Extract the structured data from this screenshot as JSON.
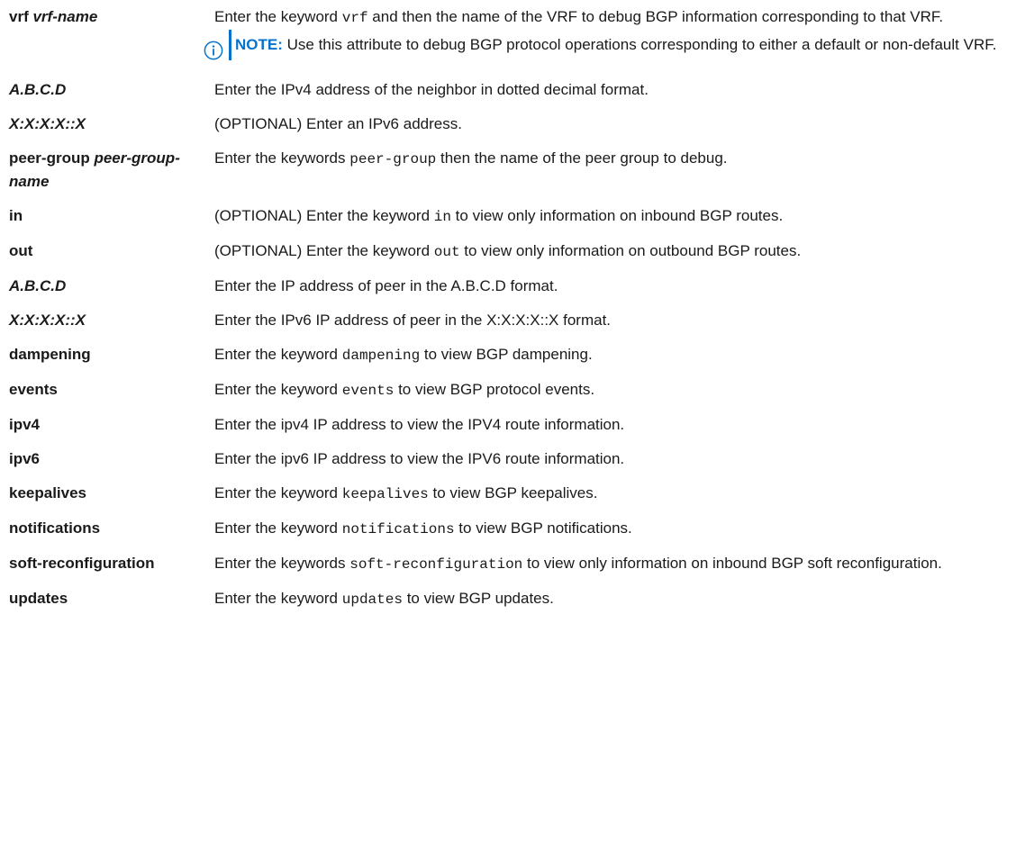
{
  "rows": [
    {
      "term": "vrf",
      "term_arg": "vrf-name",
      "desc": "Enter the keyword vrf and then the name of the VRF to debug BGP information corresponding to that VRF.",
      "desc_parts": [
        "Enter the keyword ",
        "vrf",
        " and then the name of the VRF to debug BGP information corresponding to that VRF."
      ],
      "note": {
        "label": "NOTE:",
        "text": " Use this attribute to debug BGP protocol operations corresponding to either a default or non-default VRF."
      }
    },
    {
      "term_arg": "A.B.C.D",
      "desc": "Enter the IPv4 address of the neighbor in dotted decimal format."
    },
    {
      "term_arg": "X:X:X:X::X",
      "desc": "(OPTIONAL) Enter an IPv6 address."
    },
    {
      "term": "peer-group",
      "term_arg": "peer-group-name",
      "desc_parts": [
        "Enter the keywords ",
        "peer-group",
        " then the name of the peer group to debug."
      ]
    },
    {
      "term": "in",
      "desc_parts": [
        "(OPTIONAL) Enter the keyword ",
        "in",
        " to view only information on inbound BGP routes."
      ]
    },
    {
      "term": "out",
      "desc_parts": [
        "(OPTIONAL) Enter the keyword ",
        "out",
        " to view only information on outbound BGP routes."
      ]
    },
    {
      "term_arg": "A.B.C.D",
      "desc": "Enter the IP address of peer in the A.B.C.D format."
    },
    {
      "term_arg": "X:X:X:X::X",
      "desc": "Enter the IPv6 IP address of peer in the X:X:X:X::X format."
    },
    {
      "term": "dampening",
      "desc_parts": [
        "Enter the keyword ",
        "dampening",
        " to view BGP dampening."
      ]
    },
    {
      "term": "events",
      "desc_parts": [
        "Enter the keyword ",
        "events",
        " to view BGP protocol events."
      ]
    },
    {
      "term": "ipv4",
      "desc": "Enter the ipv4 IP address to view the IPV4 route information."
    },
    {
      "term": "ipv6",
      "desc": "Enter the ipv6 IP address to view the IPV6 route information."
    },
    {
      "term": "keepalives",
      "desc_parts": [
        "Enter the keyword ",
        "keepalives",
        " to view BGP keepalives."
      ]
    },
    {
      "term": "notifications",
      "desc_parts": [
        "Enter the keyword ",
        "notifications",
        " to view BGP notifications."
      ]
    },
    {
      "term": "soft-reconfiguration",
      "desc_parts": [
        "Enter the keywords ",
        "soft-reconfiguration",
        " to view only information on inbound BGP soft reconfiguration."
      ]
    },
    {
      "term": "updates",
      "desc_parts": [
        "Enter the keyword ",
        "updates",
        " to view BGP updates."
      ]
    }
  ],
  "colors": {
    "note_accent": "#0672cb",
    "text": "#1a1a1a"
  },
  "icons": {
    "note": "info-circle-icon"
  }
}
